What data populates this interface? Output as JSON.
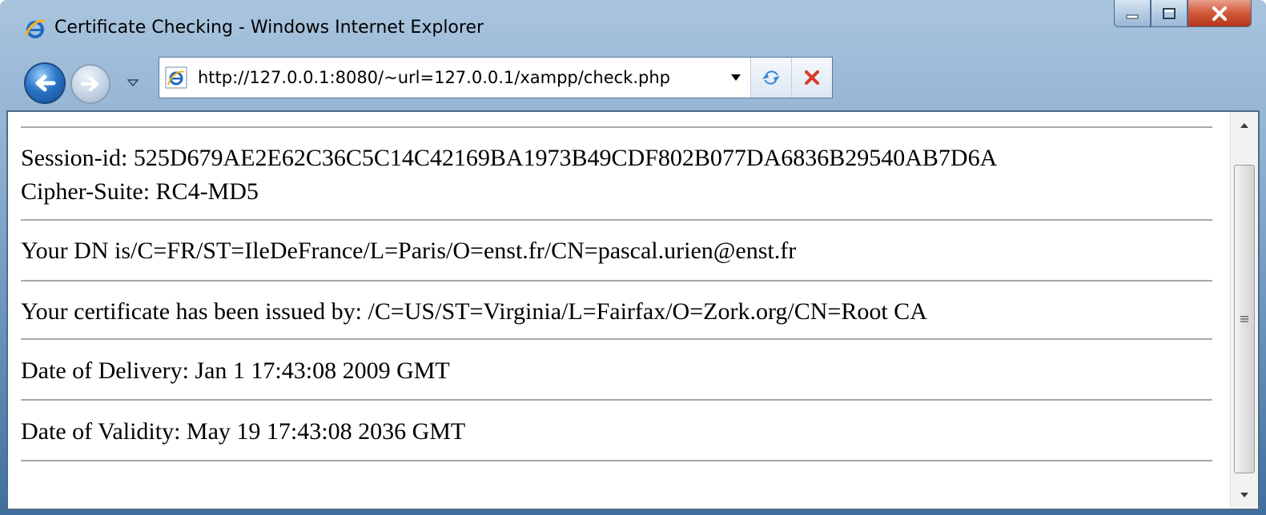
{
  "window": {
    "title": "Certificate Checking - Windows Internet Explorer"
  },
  "address": {
    "url": "http://127.0.0.1:8080/~url=127.0.0.1/xampp/check.php"
  },
  "page": {
    "session_id": "Session-id: 525D679AE2E62C36C5C14C42169BA1973B49CDF802B077DA6836B29540AB7D6A",
    "cipher_suite": "Cipher-Suite: RC4-MD5",
    "dn": "Your DN is/C=FR/ST=IleDeFrance/L=Paris/O=enst.fr/CN=pascal.urien@enst.fr",
    "issuer": "Your certificate has been issued by: /C=US/ST=Virginia/L=Fairfax/O=Zork.org/CN=Root CA",
    "delivery": "Date of Delivery: Jan 1 17:43:08 2009 GMT",
    "validity": "Date of Validity: May 19 17:43:08 2036 GMT"
  },
  "icons": {
    "browser": "ie-logo-icon",
    "page": "ie-page-icon",
    "back": "back-arrow-icon",
    "forward": "forward-arrow-icon",
    "refresh": "refresh-icon",
    "stop": "stop-icon"
  }
}
